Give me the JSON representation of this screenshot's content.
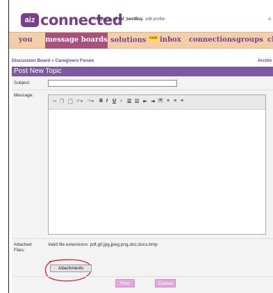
{
  "logo": {
    "box_text": "aiz",
    "word": "connected"
  },
  "login": {
    "prefix": "Logged in as: ",
    "username": "laf_bestBuy",
    "edit_link": "edit profile"
  },
  "top_right_fragment": "si",
  "nav": {
    "items": [
      {
        "label": "you"
      },
      {
        "label": "message boards",
        "active": true
      },
      {
        "label": "solutions",
        "badge": "new"
      },
      {
        "label": "inbox"
      },
      {
        "label": "connections"
      },
      {
        "label": "groups"
      },
      {
        "label": "cl"
      }
    ]
  },
  "breadcrumb": {
    "board": "Discussion Board",
    "separator": "»",
    "forum": "Caregivers Forum"
  },
  "archive_link": "Archiv",
  "form": {
    "title": "Post New Topic",
    "subject_label": "Subject:",
    "subject_value": "",
    "message_label": "Message:",
    "message_value": "",
    "attached_label_line1": "Attached",
    "attached_label_line2": "Files:",
    "valid_extensions": "Valid file extensions: pdf,gif,jpg,jpeg,png,doc,docx,bmp",
    "attachments_button": "Attachments",
    "post_button": "Post",
    "cancel_button": "Cancel"
  },
  "colors": {
    "brand_purple": "#7a3e8f",
    "nav_bg": "#f2cfa6",
    "nav_active_bg": "#a9507f",
    "header_bar": "#7b5a9f",
    "link": "#5b3bbf",
    "annotation_red": "#e02020",
    "button_pink": "#e2a9de"
  },
  "toolbar_icons": [
    "cut-icon",
    "copy-icon",
    "paste-icon",
    "undo-icon",
    "redo-icon",
    "bold-icon",
    "italic-icon",
    "underline-icon",
    "strikethrough-icon",
    "ordered-list-icon",
    "unordered-list-icon",
    "outdent-icon",
    "indent-icon",
    "align-left-icon",
    "align-center-icon",
    "align-right-icon",
    "justify-icon"
  ]
}
